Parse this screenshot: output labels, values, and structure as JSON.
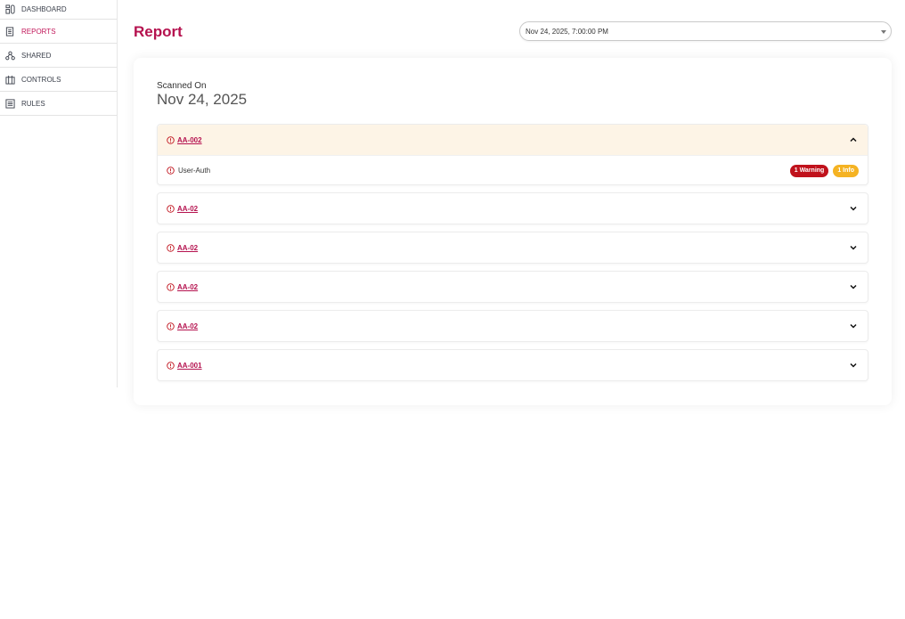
{
  "sidebar": {
    "items": [
      {
        "label": "DASHBOARD",
        "icon": "dashboard-icon",
        "active": false
      },
      {
        "label": "REPORTS",
        "icon": "report-icon",
        "active": true
      },
      {
        "label": "SHARED",
        "icon": "shared-icon",
        "active": false
      },
      {
        "label": "CONTROLS",
        "icon": "controls-icon",
        "active": false
      },
      {
        "label": "RULES",
        "icon": "rules-icon",
        "active": false
      }
    ]
  },
  "header": {
    "title": "Report",
    "date_select": {
      "value": "Nov 24, 2025, 7:00:00 PM"
    }
  },
  "report": {
    "scanned_label": "Scanned On",
    "scanned_date": "Nov 24, 2025",
    "groups": [
      {
        "title": "AA-002",
        "expanded": true,
        "rules": [
          {
            "name": "User-Auth",
            "warning_badge": "1 Warning",
            "info_badge": "1 Info"
          }
        ]
      },
      {
        "title": "AA-02",
        "expanded": false
      },
      {
        "title": "AA-02",
        "expanded": false
      },
      {
        "title": "AA-02",
        "expanded": false
      },
      {
        "title": "AA-02",
        "expanded": false
      },
      {
        "title": "AA-001",
        "expanded": false
      }
    ]
  },
  "colors": {
    "accent": "#b5124f",
    "open_header_bg": "#fdf4e6",
    "warning": "#c0121c",
    "info": "#f5b323"
  }
}
